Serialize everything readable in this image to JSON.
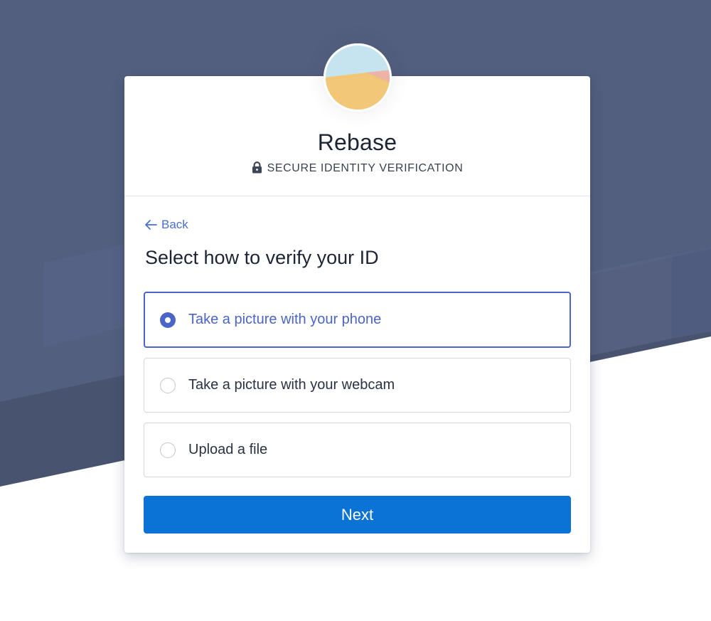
{
  "app": {
    "name": "Rebase",
    "subtitle": "SECURE IDENTITY VERIFICATION",
    "avatar_icon": "landscape-logo-icon"
  },
  "nav": {
    "back_label": "Back",
    "back_icon": "arrow-left-icon"
  },
  "form": {
    "heading": "Select how to verify your ID",
    "options": [
      {
        "label": "Take a picture with your phone",
        "selected": true
      },
      {
        "label": "Take a picture with your webcam",
        "selected": false
      },
      {
        "label": "Upload a file",
        "selected": false
      }
    ],
    "submit_label": "Next"
  },
  "colors": {
    "background": "#535f7e",
    "background_dark": "#48536f",
    "accent": "#4a64c8",
    "button": "#0b72d6",
    "text": "#1d2433"
  }
}
